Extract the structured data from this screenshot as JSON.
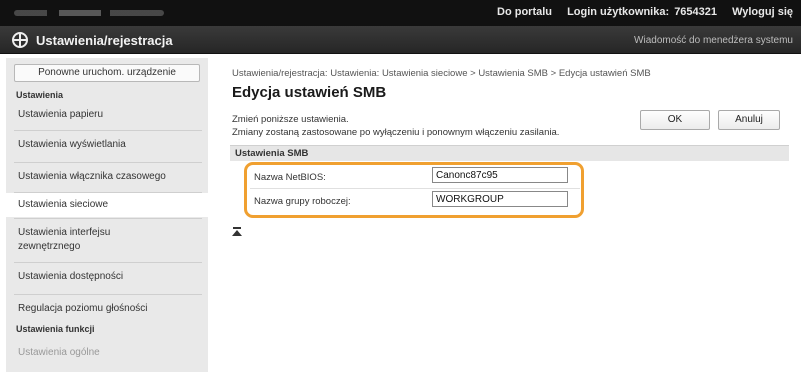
{
  "topbar": {
    "portal_link": "Do portalu",
    "login_label": "Login użytkownika:",
    "login_value": "7654321",
    "logout_link": "Wyloguj się"
  },
  "header": {
    "title": "Ustawienia/rejestracja",
    "admin_message": "Wiadomość do menedżera systemu"
  },
  "sidebar": {
    "restart_button": "Ponowne uruchom. urządzenie",
    "section_settings": "Ustawienia",
    "items": [
      {
        "label": "Ustawienia papieru"
      },
      {
        "label": "Ustawienia wyświetlania"
      },
      {
        "label": "Ustawienia włącznika czasowego"
      },
      {
        "label": "Ustawienia sieciowe"
      },
      {
        "label_line1": "Ustawienia interfejsu",
        "label_line2": "zewnętrznego"
      },
      {
        "label": "Ustawienia dostępności"
      },
      {
        "label": "Regulacja poziomu głośności"
      }
    ],
    "section_functions": "Ustawienia funkcji",
    "partial_item": "Ustawienia ogólne"
  },
  "main": {
    "breadcrumb": "Ustawienia/rejestracja: Ustawienia: Ustawienia sieciowe > Ustawienia SMB > Edycja ustawień SMB",
    "page_title": "Edycja ustawień SMB",
    "message_line1": "Zmień poniższe ustawienia.",
    "message_line2": "Zmiany zostaną zastosowane po wyłączeniu i ponownym włączeniu zasilania.",
    "ok_button": "OK",
    "cancel_button": "Anuluj",
    "section_title": "Ustawienia SMB",
    "fields": {
      "netbios_label": "Nazwa NetBIOS:",
      "netbios_value": "Canonc87c95",
      "workgroup_label": "Nazwa grupy roboczej:",
      "workgroup_value": "WORKGROUP"
    }
  },
  "colors": {
    "topbar": "#111111",
    "titlebar": "#2e2e2e",
    "sidebar": "#e9e9e9",
    "highlight": "#f0a030"
  },
  "icons": [
    "settings-icon",
    "back-to-top-icon"
  ]
}
